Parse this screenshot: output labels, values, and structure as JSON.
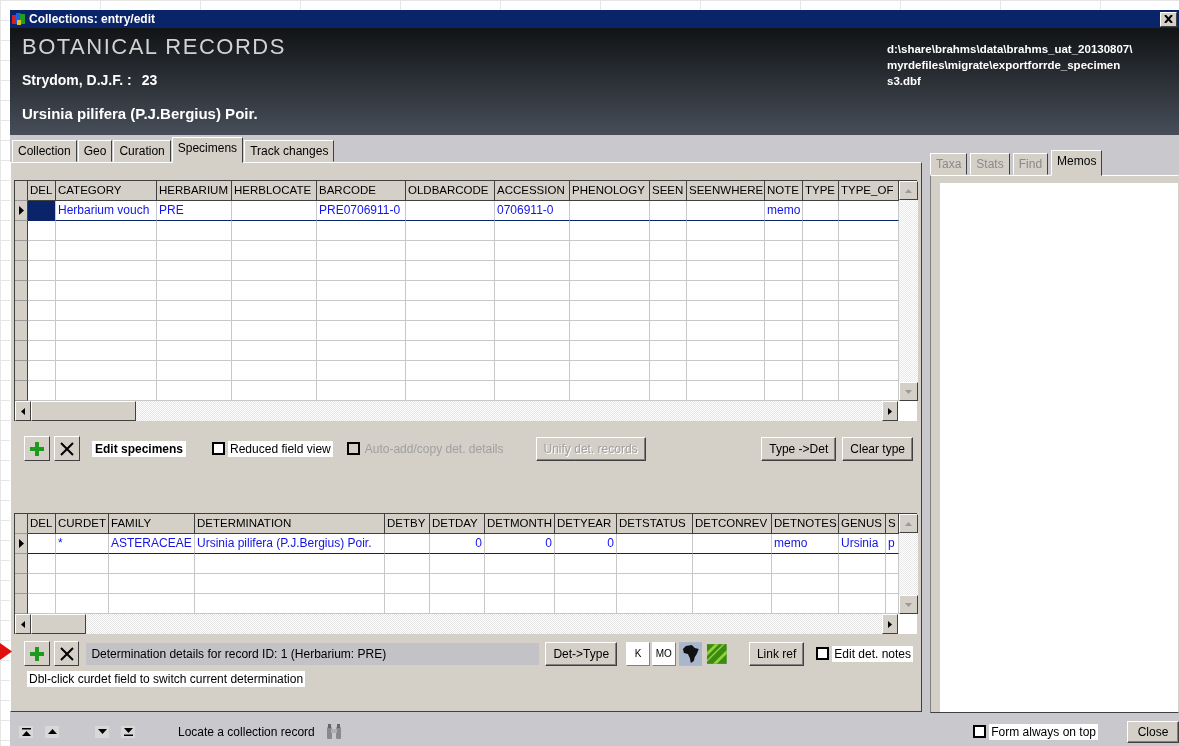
{
  "window": {
    "title": "Collections: entry/edit"
  },
  "header": {
    "title": "BOTANICAL RECORDS",
    "collector": "Strydom, D.J.F. :",
    "number": "23",
    "taxon": "Ursinia pilifera (P.J.Bergius) Poir.",
    "file_path_lines": [
      "d:\\share\\brahms\\data\\brahms_uat_20130807\\",
      "myrdefiles\\migrate\\exportforrde_specimen",
      "s3.dbf"
    ]
  },
  "tabs": [
    {
      "label": "Collection",
      "selected": false
    },
    {
      "label": "Geo",
      "selected": false
    },
    {
      "label": "Curation",
      "selected": false
    },
    {
      "label": "Specimens",
      "selected": true
    },
    {
      "label": "Track changes",
      "selected": false
    }
  ],
  "specimens": {
    "columns": [
      "DEL",
      "CATEGORY",
      "HERBARIUM",
      "HERBLOCATE",
      "BARCODE",
      "OLDBARCODE",
      "ACCESSION",
      "PHENOLOGY",
      "SEEN",
      "SEENWHERE",
      "NOTE",
      "TYPE",
      "TYPE_OF"
    ],
    "rows": [
      {
        "current": true,
        "cells": [
          {
            "selected": true
          },
          {
            "text": "Herbarium vouch"
          },
          {
            "text": "PRE"
          },
          {},
          {
            "text": "PRE0706911-0"
          },
          {},
          {
            "text": "0706911-0"
          },
          {},
          {},
          {},
          {
            "text": "memo"
          },
          {},
          {}
        ]
      }
    ]
  },
  "specimen_toolbar": {
    "label": "Edit specimens",
    "checkboxes": [
      {
        "label": "Reduced field view",
        "checked": false,
        "disabled": false
      },
      {
        "label": "Auto-add/copy det. details",
        "checked": false,
        "disabled": true
      }
    ],
    "buttons": [
      {
        "label": "Unify det. records",
        "disabled": true
      }
    ],
    "right_buttons": [
      {
        "label": "Type ->Det",
        "disabled": false
      },
      {
        "label": "Clear type",
        "disabled": false
      }
    ]
  },
  "determinations": {
    "columns": [
      "DEL",
      "CURDET",
      "FAMILY",
      "DETERMINATION",
      "DETBY",
      "DETDAY",
      "DETMONTH",
      "DETYEAR",
      "DETSTATUS",
      "DETCONREV",
      "DETNOTES",
      "GENUS",
      "S"
    ],
    "rows": [
      {
        "current": true,
        "cells": [
          {},
          {
            "text": "*"
          },
          {
            "text": "ASTERACEAE"
          },
          {
            "text": "Ursinia pilifera (P.J.Bergius) Poir."
          },
          {},
          {
            "text": "0"
          },
          {
            "text": "0"
          },
          {
            "text": "0"
          },
          {},
          {},
          {
            "text": "memo"
          },
          {
            "text": "Ursinia"
          },
          {
            "text": "p"
          }
        ]
      }
    ]
  },
  "determination_toolbar": {
    "info": "Determination details for record ID: 1 (Herbarium: PRE)",
    "buttons": [
      {
        "kind": "button",
        "label": "Det->Type"
      },
      {
        "kind": "small",
        "label": "K"
      },
      {
        "kind": "small",
        "label": "MO"
      },
      {
        "kind": "map"
      },
      {
        "kind": "leaf"
      },
      {
        "kind": "button",
        "label": "Link ref"
      }
    ],
    "checkbox": {
      "label": "Edit det. notes",
      "checked": false
    },
    "hint": "Dbl-click curdet field to switch current determination"
  },
  "side_tabs": [
    {
      "label": "Taxa",
      "selected": false,
      "disabled": true
    },
    {
      "label": "Stats",
      "selected": false,
      "disabled": true
    },
    {
      "label": "Find",
      "selected": false,
      "disabled": true
    },
    {
      "label": "Memos",
      "selected": true,
      "disabled": false
    }
  ],
  "status_bar": {
    "locate_label": "Locate a collection record",
    "on_top": {
      "label": "Form always on top",
      "checked": false
    },
    "close_button": "Close"
  }
}
